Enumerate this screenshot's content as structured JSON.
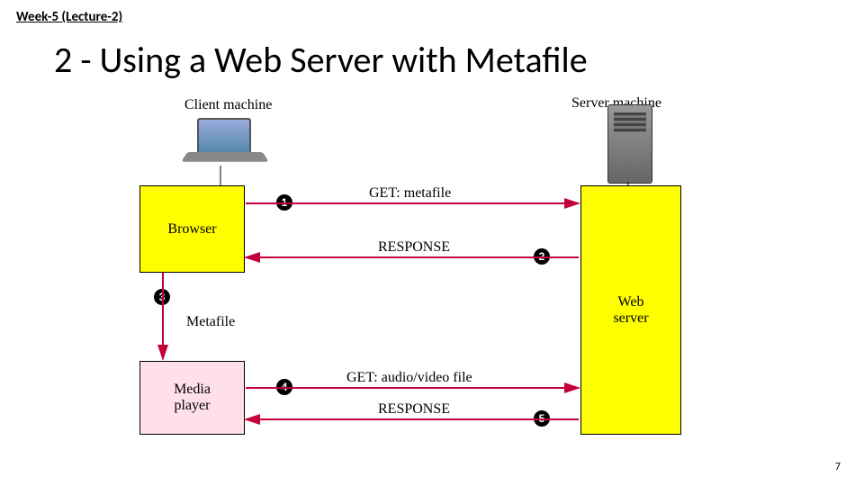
{
  "header": "Week-5 (Lecture-2)",
  "title": "2 - Using a Web Server with Metafile",
  "footer": "7",
  "diagram": {
    "client_label": "Client machine",
    "server_label": "Server machine",
    "browser": "Browser",
    "webserver_l1": "Web",
    "webserver_l2": "server",
    "media_l1": "Media",
    "media_l2": "player",
    "metafile": "Metafile",
    "msg1": "GET: metafile",
    "msg2": "RESPONSE",
    "msg4": "GET: audio/video file",
    "msg5": "RESPONSE",
    "n1": "1",
    "n2": "2",
    "n3": "3",
    "n4": "4",
    "n5": "5"
  },
  "chart_data": {
    "type": "sequence-diagram",
    "nodes": [
      {
        "id": "browser",
        "label": "Browser",
        "host": "Client machine"
      },
      {
        "id": "media",
        "label": "Media player",
        "host": "Client machine"
      },
      {
        "id": "web",
        "label": "Web server",
        "host": "Server machine"
      }
    ],
    "messages": [
      {
        "step": 1,
        "from": "browser",
        "to": "web",
        "label": "GET: metafile"
      },
      {
        "step": 2,
        "from": "web",
        "to": "browser",
        "label": "RESPONSE"
      },
      {
        "step": 3,
        "from": "browser",
        "to": "media",
        "label": "Metafile"
      },
      {
        "step": 4,
        "from": "media",
        "to": "web",
        "label": "GET: audio/video file"
      },
      {
        "step": 5,
        "from": "web",
        "to": "media",
        "label": "RESPONSE"
      }
    ]
  }
}
